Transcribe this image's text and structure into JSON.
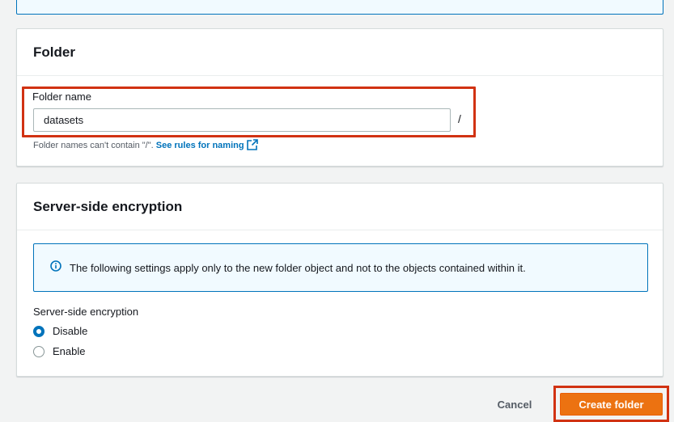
{
  "colors": {
    "accent": "#0073bb",
    "primary_button": "#ec7211",
    "highlight": "#d13212"
  },
  "folder": {
    "title": "Folder",
    "field_label": "Folder name",
    "value": "datasets",
    "suffix": "/",
    "hint_text": "Folder names can't contain \"/\". ",
    "hint_link": "See rules for naming",
    "hint_link_icon": "external-link-icon"
  },
  "encryption": {
    "title": "Server-side encryption",
    "info_icon": "info-icon",
    "info_text": "The following settings apply only to the new folder object and not to the objects contained within it.",
    "group_label": "Server-side encryption",
    "options": [
      {
        "label": "Disable",
        "selected": true
      },
      {
        "label": "Enable",
        "selected": false
      }
    ]
  },
  "footer": {
    "cancel_label": "Cancel",
    "create_label": "Create folder"
  }
}
